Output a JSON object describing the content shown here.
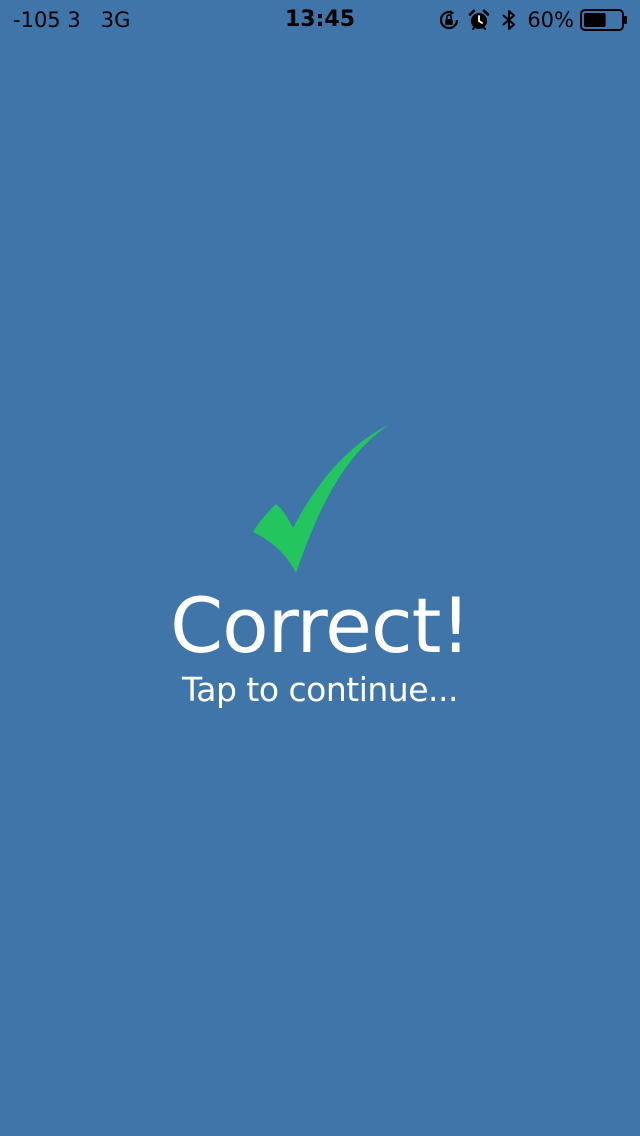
{
  "status_bar": {
    "signal": "-105 3",
    "network": "3G",
    "time": "13:45",
    "battery_percent": "60%",
    "battery_level": 0.6,
    "icons": [
      "rotation-lock-icon",
      "alarm-icon",
      "bluetooth-icon",
      "battery-icon"
    ]
  },
  "result": {
    "title": "Correct!",
    "hint": "Tap to continue...",
    "icon": "checkmark-icon"
  },
  "colors": {
    "background": "#4075aa",
    "checkmark": "#22c55e",
    "text": "#ffffff",
    "status_text": "#000000"
  }
}
